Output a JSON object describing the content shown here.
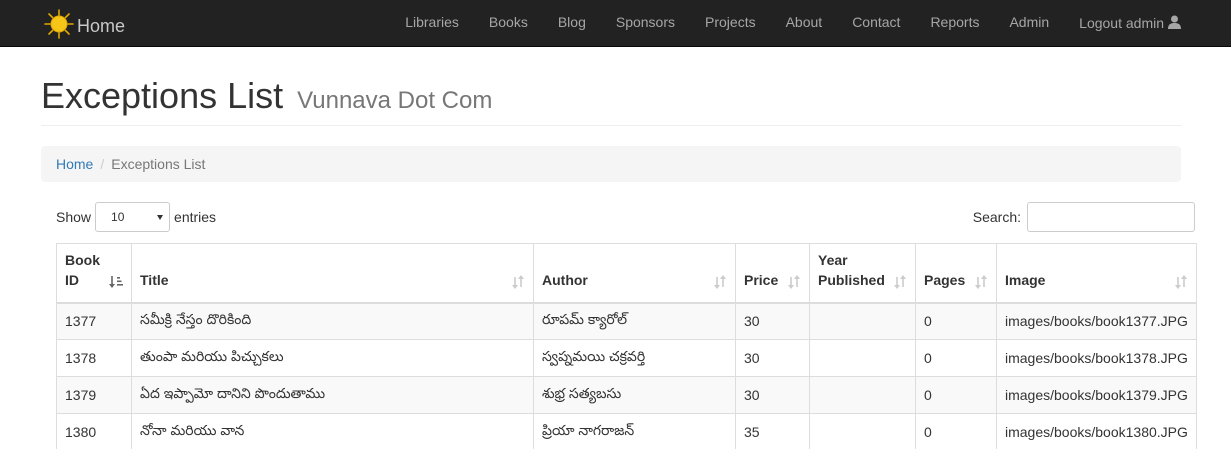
{
  "navbar": {
    "brand_label": "Home",
    "items": [
      "Libraries",
      "Books",
      "Blog",
      "Sponsors",
      "Projects",
      "About",
      "Contact",
      "Reports",
      "Admin",
      "Logout admin"
    ]
  },
  "header": {
    "title": "Exceptions List",
    "subtitle": "Vunnava Dot Com"
  },
  "breadcrumb": {
    "home": "Home",
    "separator": "/",
    "current": "Exceptions List"
  },
  "length_control": {
    "prefix": "Show",
    "value": "10",
    "suffix": "entries"
  },
  "search": {
    "label": "Search:",
    "value": ""
  },
  "table": {
    "columns": [
      {
        "line1": "Book",
        "line2": "ID"
      },
      {
        "line1": "",
        "line2": "Title"
      },
      {
        "line1": "",
        "line2": "Author"
      },
      {
        "line1": "",
        "line2": "Price"
      },
      {
        "line1": "Year",
        "line2": "Published"
      },
      {
        "line1": "",
        "line2": "Pages"
      },
      {
        "line1": "",
        "line2": "Image"
      }
    ],
    "rows": [
      [
        "1377",
        "సమీక్రి నేస్తం దొరికింది",
        "రూపమ్ క్యారోల్",
        "30",
        "",
        "0",
        "images/books/book1377.JPG"
      ],
      [
        "1378",
        "తుంపా మరియు పిచ్చుకలు",
        "స్వప్నమయి చక్రవర్తి",
        "30",
        "",
        "0",
        "images/books/book1378.JPG"
      ],
      [
        "1379",
        "ఏద ఇప్పామో దానిని పొందుతాము",
        "శుభ్ర సత్యబసు",
        "30",
        "",
        "0",
        "images/books/book1379.JPG"
      ],
      [
        "1380",
        "నోనా మరియు వాన",
        "ప్రియా నాగరాజన్",
        "35",
        "",
        "0",
        "images/books/book1380.JPG"
      ]
    ]
  },
  "colors": {
    "navbar_bg": "#222222",
    "link": "#337ab7",
    "sun": "#f5c518"
  }
}
